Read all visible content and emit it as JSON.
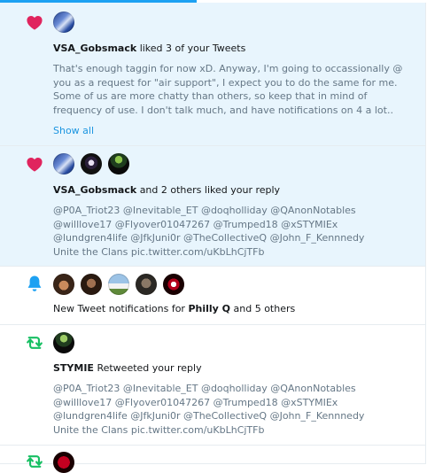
{
  "notifications": [
    {
      "type": "like",
      "user": "VSA_Gobsmack",
      "action": "liked 3 of your Tweets",
      "text": "That's enough taggin for now xD.  Anyway, I'm going to occassionally @ you as a request for \"air support\", I expect you to do the same for me.  Some of us are more chatty than others, so keep that in mind of frequency of use. I don't talk much, and have notifications on 4 a lot..",
      "show_all": "Show all"
    },
    {
      "type": "like",
      "user": "VSA_Gobsmack",
      "action": "and 2 others liked your reply",
      "text": "@P0A_Triot23 @Inevitable_ET @doqholliday @QAnonNotables @willlove17 @Flyover01047267 @Trumped18 @xSTYMIEx @lundgren4life @JfkJuni0r @TheCollectiveQ @John_F_Kennnedy",
      "link": "Unite the Clans pic.twitter.com/uKbLhCjTFb"
    },
    {
      "type": "notification",
      "prefix": "New Tweet notifications for",
      "user": "Philly Q",
      "suffix": "and 5 others"
    },
    {
      "type": "retweet",
      "user": "STYMIE",
      "action": "Retweeted your reply",
      "text": "@P0A_Triot23 @Inevitable_ET @doqholliday @QAnonNotables @willlove17 @Flyover01047267 @Trumped18 @xSTYMIEx @lundgren4life @JfkJuni0r @TheCollectiveQ @John_F_Kennnedy",
      "link": "Unite the Clans pic.twitter.com/uKbLhCjTFb"
    },
    {
      "type": "retweet"
    }
  ],
  "colors": {
    "like": "#e0245e",
    "notify": "#1da1f2",
    "retweet": "#17bf63",
    "link": "#1b95e0",
    "unread_bg": "#e8f5fd"
  },
  "icons": [
    "heart-icon",
    "bell-icon",
    "retweet-icon"
  ]
}
